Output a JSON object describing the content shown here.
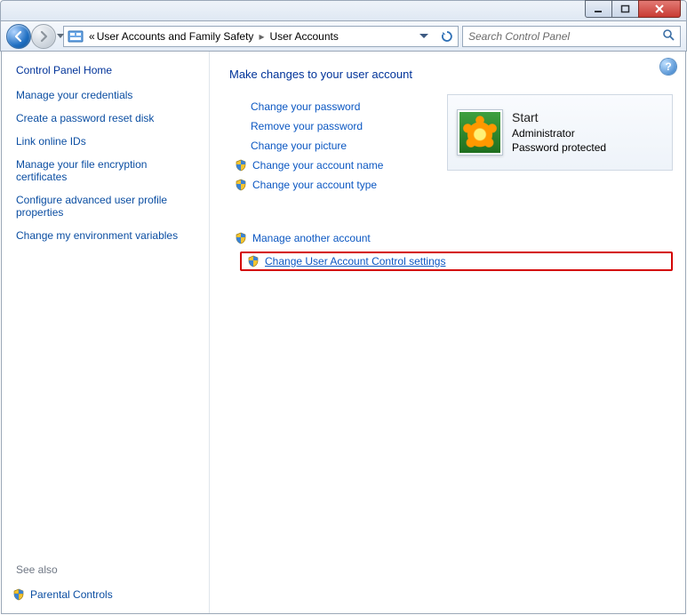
{
  "breadcrumb": {
    "prefix": "«",
    "parent": "User Accounts and Family Safety",
    "current": "User Accounts"
  },
  "search": {
    "placeholder": "Search Control Panel"
  },
  "sidebar": {
    "home": "Control Panel Home",
    "links": [
      "Manage your credentials",
      "Create a password reset disk",
      "Link online IDs",
      "Manage your file encryption certificates",
      "Configure advanced user profile properties",
      "Change my environment variables"
    ],
    "see_also_label": "See also",
    "see_also_link": "Parental Controls"
  },
  "main": {
    "heading": "Make changes to your user account",
    "tasks_plain": [
      "Change your password",
      "Remove your password",
      "Change your picture"
    ],
    "tasks_shield": [
      "Change your account name",
      "Change your account type"
    ],
    "tasks_lower_shield": [
      "Manage another account",
      "Change User Account Control settings"
    ]
  },
  "account": {
    "name": "Start",
    "role": "Administrator",
    "protection": "Password protected"
  }
}
